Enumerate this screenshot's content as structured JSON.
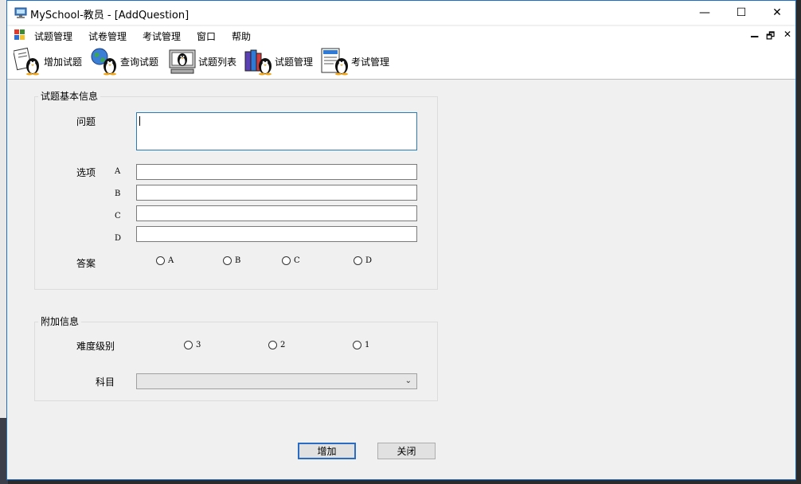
{
  "window": {
    "title": "MySchool-教员 - [AddQuestion]",
    "controls": {
      "minimize": "—",
      "maximize": "☐",
      "close": "✕"
    }
  },
  "menu": {
    "items": [
      "试题管理",
      "试卷管理",
      "考试管理",
      "窗口",
      "帮助"
    ],
    "mdi": {
      "minimize": "▁",
      "restore": "🗗",
      "close": "✕"
    }
  },
  "toolbar": {
    "items": [
      {
        "label": "增加试题",
        "icon": "penguin-paper-icon"
      },
      {
        "label": "查询试题",
        "icon": "penguin-globe-icon"
      },
      {
        "label": "试题列表",
        "icon": "penguin-computer-icon"
      },
      {
        "label": "试题管理",
        "icon": "penguin-books-icon"
      },
      {
        "label": "考试管理",
        "icon": "penguin-document-icon"
      }
    ]
  },
  "basic_info": {
    "group_title": "试题基本信息",
    "question_label": "问题",
    "question_value": "",
    "options_label": "选项",
    "options": [
      {
        "letter": "A",
        "value": ""
      },
      {
        "letter": "B",
        "value": ""
      },
      {
        "letter": "C",
        "value": ""
      },
      {
        "letter": "D",
        "value": ""
      }
    ],
    "answer_label": "答案",
    "answers": [
      "A",
      "B",
      "C",
      "D"
    ]
  },
  "extra_info": {
    "group_title": "附加信息",
    "difficulty_label": "难度级别",
    "difficulty_options": [
      "3",
      "2",
      "1"
    ],
    "subject_label": "科目",
    "subject_value": ""
  },
  "buttons": {
    "add": "增加",
    "close": "关闭"
  },
  "colors": {
    "focus_border": "#2a7cb8",
    "window_border": "#1e6fc7",
    "default_button_border": "#2a6bc4"
  }
}
